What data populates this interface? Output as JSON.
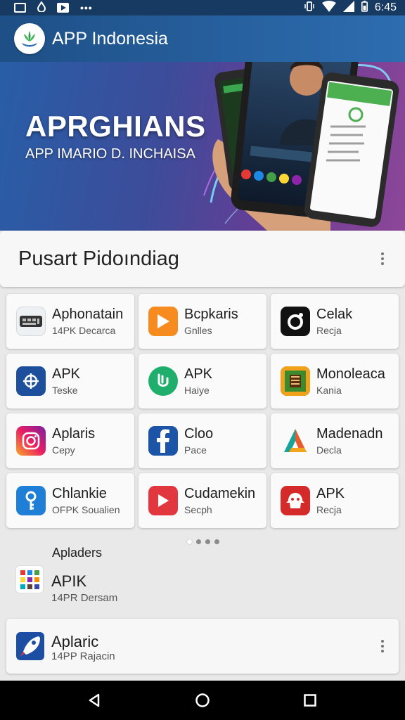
{
  "status_bar": {
    "time": "6:45"
  },
  "app_bar": {
    "title": "APP Indonesia"
  },
  "hero": {
    "title": "APRGHIANS",
    "subtitle": "APP IMARIO D. INCHAISA"
  },
  "section": {
    "title": "Pusart Pidoındiag"
  },
  "grid": {
    "tiles": [
      {
        "name": "Aphonatain",
        "subtitle": "14PK Decarca",
        "icon": "keyboard-icon"
      },
      {
        "name": "Bcpkaris",
        "subtitle": "Gnlles",
        "icon": "play-icon"
      },
      {
        "name": "Celak",
        "subtitle": "Recja",
        "icon": "camera-ring-icon"
      },
      {
        "name": "APK",
        "subtitle": "Teske",
        "icon": "target-icon"
      },
      {
        "name": "APK",
        "subtitle": "Haiye",
        "icon": "phone-icon"
      },
      {
        "name": "Monoleaca",
        "subtitle": "Kania",
        "icon": "game-icon"
      },
      {
        "name": "Aplaris",
        "subtitle": "Cepy",
        "icon": "instagram-icon"
      },
      {
        "name": "Cloo",
        "subtitle": "Pace",
        "icon": "facebook-icon"
      },
      {
        "name": "Madenadn",
        "subtitle": "Decla",
        "icon": "triangle-logo-icon"
      },
      {
        "name": "Chlankie",
        "subtitle": "OFPK Soualien",
        "icon": "key-icon"
      },
      {
        "name": "Cudamekin",
        "subtitle": "Secph",
        "icon": "youtube-icon"
      },
      {
        "name": "APK",
        "subtitle": "Recja",
        "icon": "robot-icon"
      }
    ]
  },
  "subheading": "Apladers",
  "list": [
    {
      "title": "APIK",
      "subtitle": "14PR Dersam",
      "icon": "app-grid-icon"
    },
    {
      "title": "Aplaric",
      "subtitle": "14PP Rajacin",
      "icon": "rocket-icon"
    }
  ],
  "colors": {
    "app_bar": "#2d6db0",
    "hero_start": "#285ea7",
    "hero_end": "#8d4799",
    "background": "#e9e9e9"
  }
}
